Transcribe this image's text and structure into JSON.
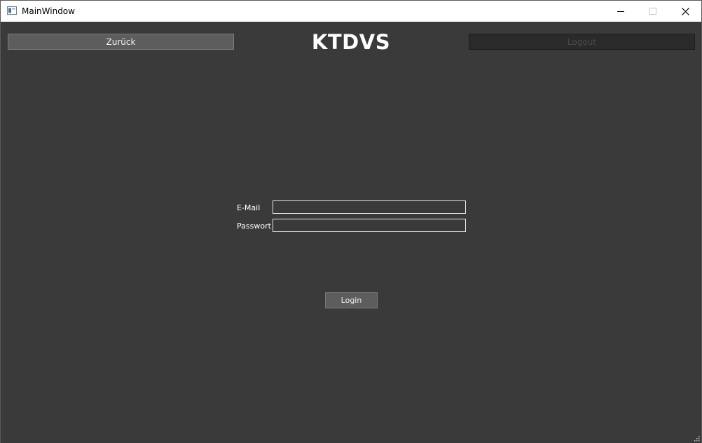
{
  "window": {
    "title": "MainWindow",
    "icon": "window-app-icon",
    "controls": {
      "minimize_icon": "minimize-icon",
      "maximize_icon": "maximize-icon",
      "close_icon": "close-icon"
    }
  },
  "header": {
    "back_label": "Zurück",
    "title": "KTDVS",
    "logout_label": "Logout",
    "logout_enabled": false
  },
  "login_form": {
    "email_label": "E-Mail",
    "email_value": "",
    "password_label": "Passwort",
    "password_value": "",
    "submit_label": "Login"
  },
  "colors": {
    "background": "#3a3a3a",
    "button": "#5d5d5d",
    "disabled_button": "#2a2a2a",
    "text": "#ffffff",
    "titlebar": "#ffffff"
  }
}
